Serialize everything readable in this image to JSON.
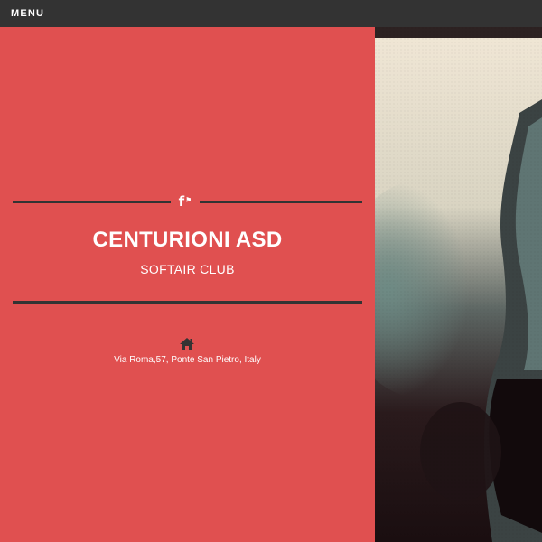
{
  "topbar": {
    "menu_label": "MENU"
  },
  "club": {
    "title": "CENTURIONI ASD",
    "subtitle": "SOFTAIR CLUB",
    "address": "Via Roma,57, Ponte San Pietro, Italy"
  },
  "social": {
    "icon": "facebook-icon",
    "glyph": "f"
  },
  "icons": {
    "home": "home-icon"
  },
  "colors": {
    "panel": "#e05050",
    "topbar": "#333333",
    "divider": "#333333",
    "text": "#ffffff"
  }
}
